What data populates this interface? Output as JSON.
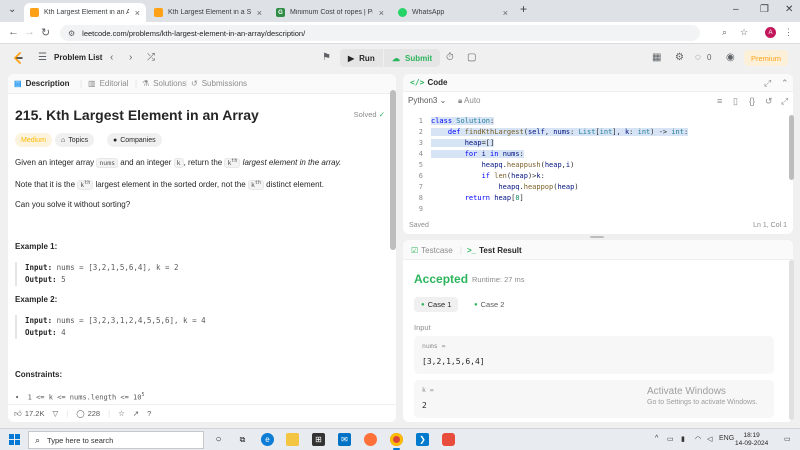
{
  "browser": {
    "tabs": [
      {
        "title": "Kth Largest Element in an Array",
        "active": true,
        "favicon": "leetcode-favicon"
      },
      {
        "title": "Kth Largest Element in a Stream",
        "active": false,
        "favicon": "leetcode-favicon"
      },
      {
        "title": "Minimum Cost of ropes | Practice",
        "active": false,
        "favicon": "gfg-favicon"
      },
      {
        "title": "WhatsApp",
        "active": false,
        "favicon": "whatsapp-favicon"
      }
    ],
    "url": "leetcode.com/problems/kth-largest-element-in-an-array/description/",
    "profile_initial": "A"
  },
  "leetcode_nav": {
    "problem_list": "Problem List",
    "run": "Run",
    "submit": "Submit",
    "coins": "0",
    "premium": "Premium"
  },
  "description_panel": {
    "tabs": [
      "Description",
      "Editorial",
      "Solutions",
      "Submissions"
    ],
    "title": "215. Kth Largest Element in an Array",
    "status": "Solved",
    "difficulty": "Medium",
    "chips": [
      "Topics",
      "Companies"
    ],
    "para1": {
      "a": "Given an integer array ",
      "code1": "nums",
      "b": " and an integer ",
      "code2": "k",
      "c": ", return the ",
      "code3": "k",
      "sup": "th",
      "d": " largest element in the array."
    },
    "para2": {
      "a": "Note that it is the ",
      "code1": "k",
      "sup1": "th",
      "b": " largest element in the sorted order, not the ",
      "code2": "k",
      "sup2": "th",
      "c": " distinct element."
    },
    "para3": "Can you solve it without sorting?",
    "examples": [
      {
        "title": "Example 1:",
        "input_label": "Input:",
        "input": "nums = [3,2,1,5,6,4], k = 2",
        "output_label": "Output:",
        "output": "5"
      },
      {
        "title": "Example 2:",
        "input_label": "Input:",
        "input": "nums = [3,2,3,1,2,4,5,5,6], k = 4",
        "output_label": "Output:",
        "output": "4"
      }
    ],
    "constraints_title": "Constraints:",
    "constraint1": "1 <= k <= nums.length <= 10",
    "constraint1_sup": "5",
    "likes": "17.2K",
    "comments": "228"
  },
  "code_panel": {
    "title": "Code",
    "language": "Python3",
    "autosave": "Auto",
    "saved": "Saved",
    "cursor": "Ln 1, Col 1",
    "line_numbers": [
      "1",
      "2",
      "3",
      "4",
      "5",
      "6",
      "7",
      "8",
      "9"
    ]
  },
  "result_panel": {
    "tabs": [
      "Testcase",
      "Test Result"
    ],
    "status": "Accepted",
    "runtime": "Runtime: 27 ms",
    "cases": [
      "Case 1",
      "Case 2"
    ],
    "input_label": "Input",
    "var1_name": "nums =",
    "var1_value": "[3,2,1,5,6,4]",
    "var2_name": "k =",
    "var2_value": "2"
  },
  "watermark": {
    "line1": "Activate Windows",
    "line2": "Go to Settings to activate Windows."
  },
  "taskbar": {
    "search_placeholder": "Type here to search",
    "lang": "ENG",
    "time": "18:19",
    "date": "14-09-2024"
  },
  "colors": {
    "accent_green": "#2db55d",
    "leetcode_orange": "#ffa116",
    "medium_yellow": "#ffb800"
  }
}
